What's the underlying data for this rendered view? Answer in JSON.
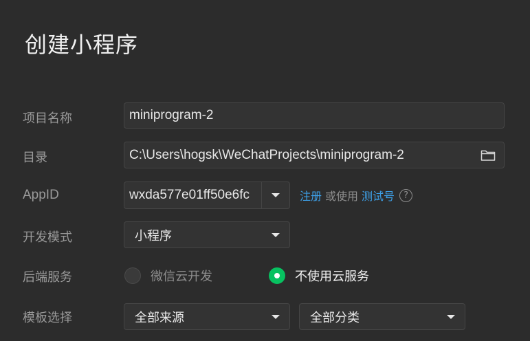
{
  "dialog": {
    "title": "创建小程序"
  },
  "form": {
    "project_name": {
      "label": "项目名称",
      "value": "miniprogram-2"
    },
    "directory": {
      "label": "目录",
      "value": "C:\\Users\\hogsk\\WeChatProjects\\miniprogram-2",
      "icon": "folder-icon"
    },
    "appid": {
      "label": "AppID",
      "value": "wxda577e01ff50e6fc",
      "register_link": "注册",
      "or_use_text": "或使用",
      "test_account_link": "测试号",
      "help_icon": "?"
    },
    "dev_mode": {
      "label": "开发模式",
      "selected": "小程序"
    },
    "backend": {
      "label": "后端服务",
      "options": [
        {
          "label": "微信云开发",
          "selected": false
        },
        {
          "label": "不使用云服务",
          "selected": true
        }
      ]
    },
    "template": {
      "label": "模板选择",
      "source_selected": "全部来源",
      "category_selected": "全部分类"
    }
  },
  "colors": {
    "background": "#2c2c2c",
    "link": "#3d9fe6",
    "radio_selected": "#07c160"
  }
}
